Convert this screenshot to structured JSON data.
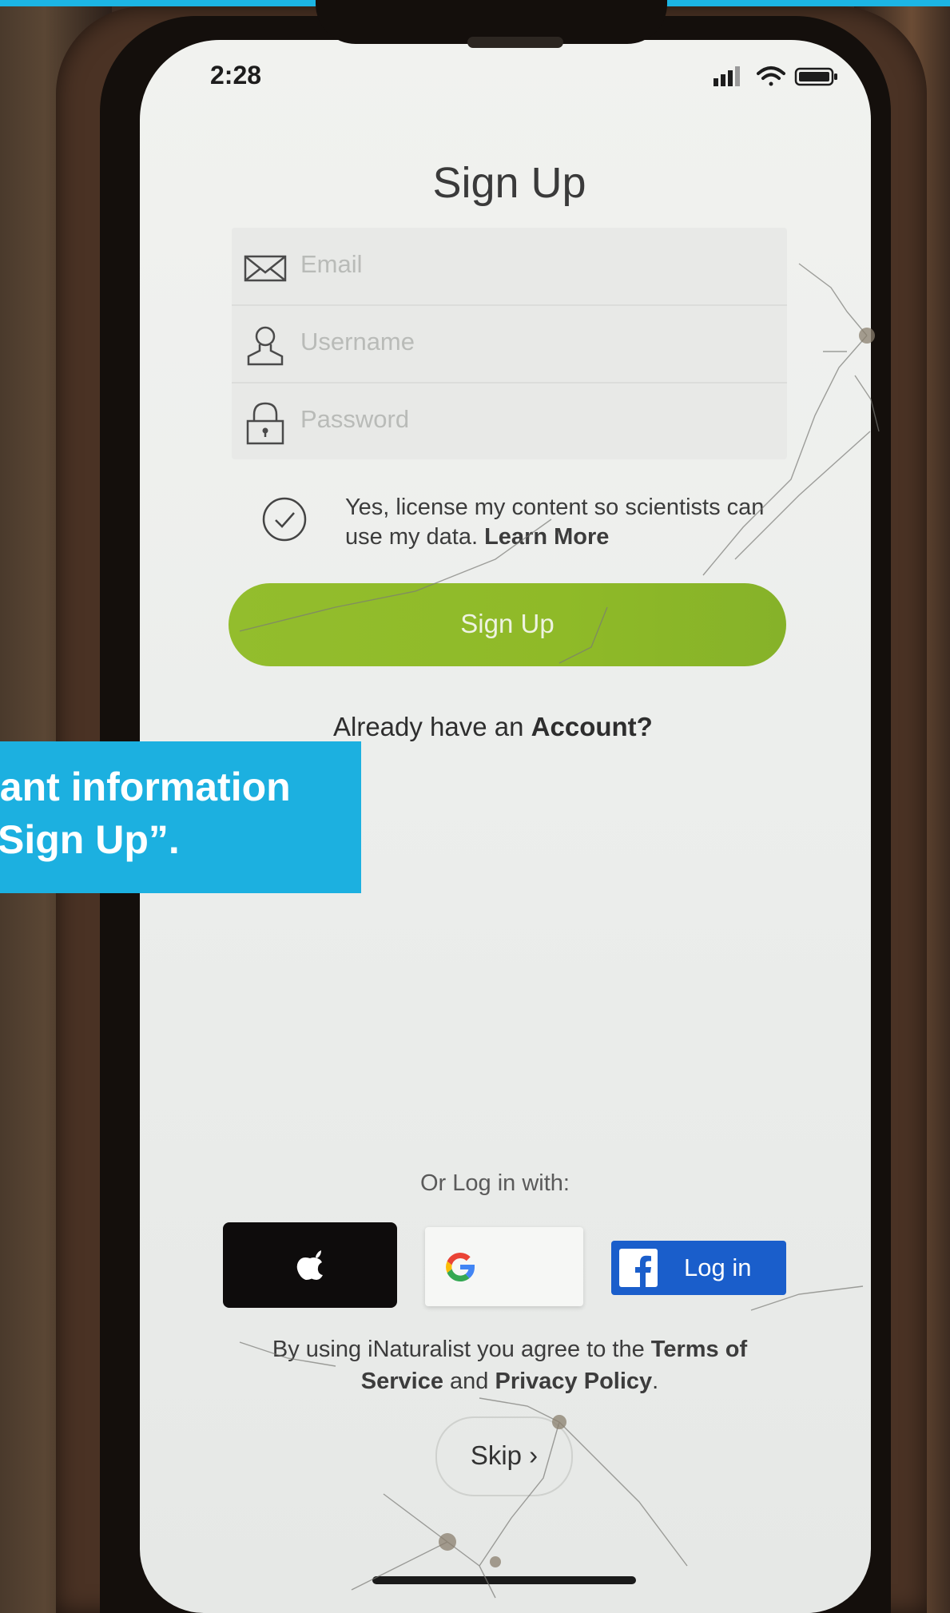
{
  "status_bar": {
    "time": "2:28"
  },
  "screen": {
    "title": "Sign Up"
  },
  "form": {
    "email_placeholder": "Email",
    "username_placeholder": "Username",
    "password_placeholder": "Password"
  },
  "license": {
    "text": "Yes, license my content so scientists can use my data.",
    "link": "Learn More",
    "checked": true
  },
  "signup_button": {
    "label": "Sign Up"
  },
  "account": {
    "prefix": "Already have an",
    "link": "Account?"
  },
  "overlay": {
    "line1": "vant information",
    "line2": "“Sign Up”."
  },
  "social": {
    "heading": "Or Log in with:",
    "facebook_label": "Log in"
  },
  "terms": {
    "prefix": "By using iNaturalist you agree to the",
    "terms_link": "Terms of Service",
    "conjunction": "and",
    "privacy_link": "Privacy Policy",
    "suffix": "."
  },
  "skip": {
    "label": "Skip ›"
  },
  "colors": {
    "accent_green": "#8fba28",
    "facebook_blue": "#1a5ecb",
    "banner_blue": "#1cb0e0",
    "apple_black": "#0e0c0c"
  },
  "icons": {
    "email": "envelope-icon",
    "username": "person-icon",
    "password": "lock-icon",
    "license": "checkmark-circle-icon",
    "apple": "apple-logo-icon",
    "google": "google-logo-icon",
    "facebook": "facebook-logo-icon"
  }
}
